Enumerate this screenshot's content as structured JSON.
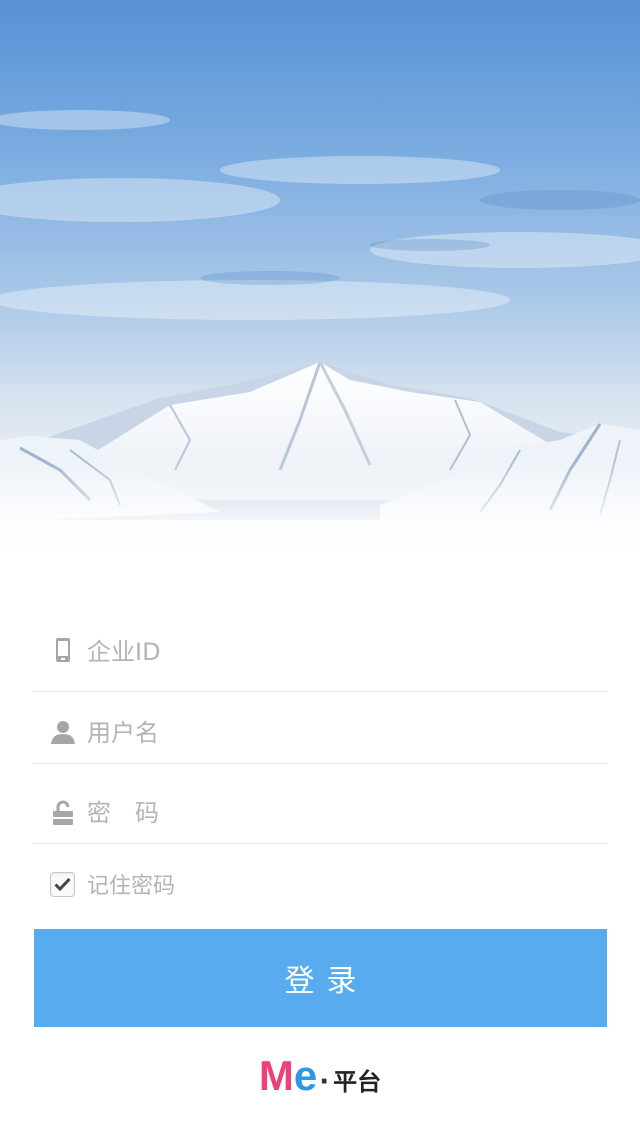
{
  "login_form": {
    "company_id": {
      "placeholder": "企业ID",
      "value": "",
      "icon": "phone-icon"
    },
    "username": {
      "placeholder": "用户名",
      "value": "",
      "icon": "user-icon"
    },
    "password": {
      "placeholder": "密　码",
      "value": "",
      "icon": "unlock-icon"
    },
    "remember": {
      "label": "记住密码",
      "checked": true
    },
    "submit_label": "登录"
  },
  "brand": {
    "m": "M",
    "e": "e",
    "dot": "·",
    "text": "平台",
    "m_color": "#ee3f78",
    "e_color": "#2e97e6"
  },
  "colors": {
    "accent": "#57abee",
    "placeholder": "#b4b4b4",
    "divider": "#e6e6e6"
  }
}
